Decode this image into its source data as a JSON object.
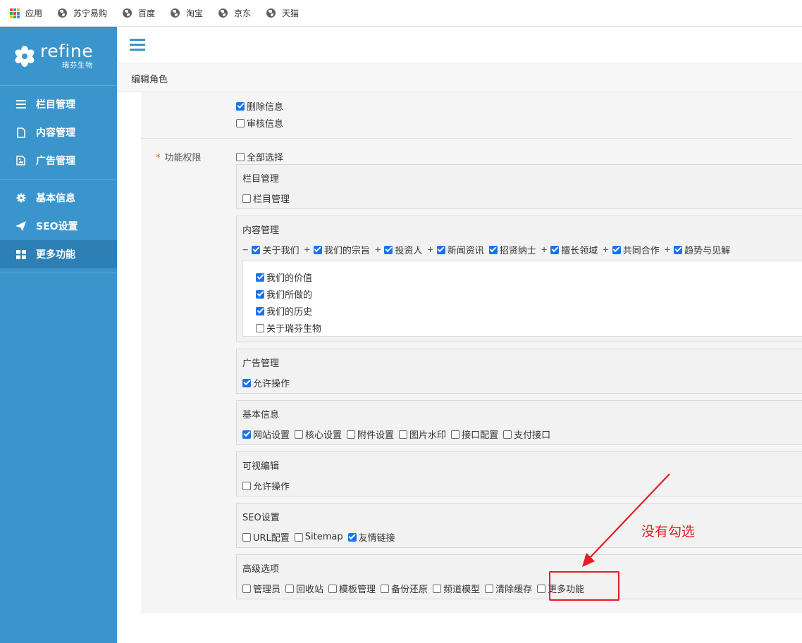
{
  "bookmarks": {
    "apps_label": "应用",
    "items": [
      "苏宁易购",
      "百度",
      "淘宝",
      "京东",
      "天猫"
    ]
  },
  "sidebar": {
    "logo_en": "refine",
    "logo_cn": "瑞芬生物",
    "groups": [
      [
        {
          "label": "栏目管理",
          "icon": "list-icon"
        },
        {
          "label": "内容管理",
          "icon": "document-icon"
        },
        {
          "label": "广告管理",
          "icon": "image-icon"
        }
      ],
      [
        {
          "label": "基本信息",
          "icon": "gear-icon"
        },
        {
          "label": "SEO设置",
          "icon": "send-icon"
        },
        {
          "label": "更多功能",
          "icon": "grid-icon",
          "active": true
        }
      ]
    ]
  },
  "breadcrumb": "编辑角色",
  "top_checks": [
    {
      "label": "删除信息",
      "checked": true
    },
    {
      "label": "审核信息",
      "checked": false
    }
  ],
  "func": {
    "label": "功能权限",
    "select_all": {
      "label": "全部选择",
      "checked": false
    }
  },
  "groups": [
    {
      "title": "栏目管理",
      "items": [
        {
          "label": "栏目管理",
          "checked": false
        }
      ]
    },
    {
      "title": "内容管理",
      "items": [
        {
          "label": "关于我们",
          "checked": true,
          "toggle": "−"
        },
        {
          "label": "我们的宗旨",
          "checked": true,
          "toggle": "+"
        },
        {
          "label": "投资人",
          "checked": true,
          "toggle": "+"
        },
        {
          "label": "新闻资讯",
          "checked": true,
          "toggle": "+"
        },
        {
          "label": "招贤纳士",
          "checked": true,
          "toggle": ""
        },
        {
          "label": "擅长领域",
          "checked": true,
          "toggle": "+"
        },
        {
          "label": "共同合作",
          "checked": true,
          "toggle": "+"
        },
        {
          "label": "趋势与见解",
          "checked": true,
          "toggle": "+"
        }
      ],
      "sub_items": [
        {
          "label": "我们的价值",
          "checked": true
        },
        {
          "label": "我们所做的",
          "checked": true
        },
        {
          "label": "我们的历史",
          "checked": true
        },
        {
          "label": "关于瑞芬生物",
          "checked": false
        }
      ]
    },
    {
      "title": "广告管理",
      "items": [
        {
          "label": "允许操作",
          "checked": true
        }
      ]
    },
    {
      "title": "基本信息",
      "items": [
        {
          "label": "网站设置",
          "checked": true
        },
        {
          "label": "核心设置",
          "checked": false
        },
        {
          "label": "附件设置",
          "checked": false
        },
        {
          "label": "图片水印",
          "checked": false
        },
        {
          "label": "接口配置",
          "checked": false
        },
        {
          "label": "支付接口",
          "checked": false
        }
      ]
    },
    {
      "title": "可视编辑",
      "items": [
        {
          "label": "允许操作",
          "checked": false
        }
      ]
    },
    {
      "title": "SEO设置",
      "items": [
        {
          "label": "URL配置",
          "checked": false
        },
        {
          "label": "Sitemap",
          "checked": false
        },
        {
          "label": "友情链接",
          "checked": true
        }
      ]
    },
    {
      "title": "高级选项",
      "items": [
        {
          "label": "管理员",
          "checked": false
        },
        {
          "label": "回收站",
          "checked": false
        },
        {
          "label": "模板管理",
          "checked": false
        },
        {
          "label": "备份还原",
          "checked": false
        },
        {
          "label": "频道模型",
          "checked": false
        },
        {
          "label": "清除缓存",
          "checked": false
        },
        {
          "label": "更多功能",
          "checked": false
        }
      ]
    }
  ],
  "annotation": {
    "text": "没有勾选",
    "color": "#e51c23"
  },
  "colors": {
    "sidebar": "#3a95cc",
    "sidebar_active": "#2d80b5",
    "checkbox": "#1a73e8"
  }
}
